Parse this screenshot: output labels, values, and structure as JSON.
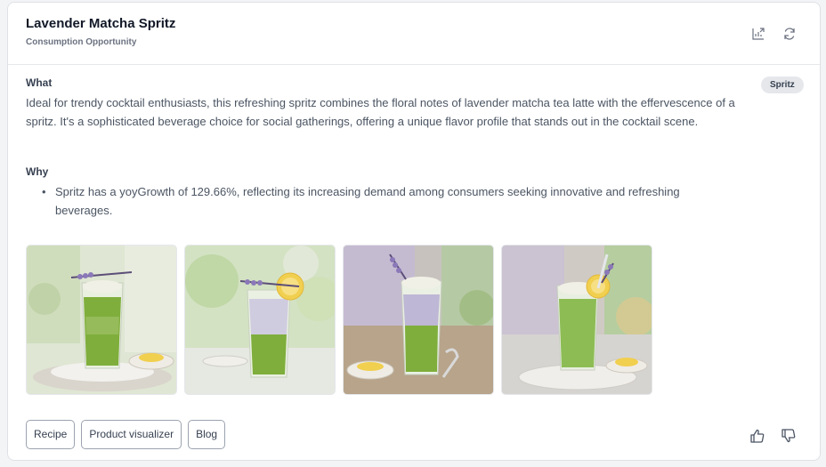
{
  "card": {
    "title": "Lavender Matcha Spritz",
    "subtitle": "Consumption Opportunity",
    "tag": "Spritz"
  },
  "what": {
    "label": "What",
    "text": "Ideal for trendy cocktail enthusiasts, this refreshing spritz combines the floral notes of lavender matcha tea latte with the effervescence of a spritz. It's a sophisticated beverage choice for social gatherings, offering a unique flavor profile that stands out in the cocktail scene."
  },
  "why": {
    "label": "Why",
    "items": [
      "Spritz has a yoyGrowth of 129.66%, reflecting its increasing demand among consumers seeking innovative and refreshing beverages."
    ]
  },
  "images": [
    {
      "name": "lavender-matcha-spritz-image-1"
    },
    {
      "name": "lavender-matcha-spritz-image-2"
    },
    {
      "name": "lavender-matcha-spritz-image-3"
    },
    {
      "name": "lavender-matcha-spritz-image-4"
    }
  ],
  "actions": {
    "recipe": "Recipe",
    "product_visualizer": "Product visualizer",
    "blog": "Blog"
  },
  "icons": {
    "export": "chart-export-icon",
    "refresh": "refresh-icon",
    "like": "thumbs-up-icon",
    "dislike": "thumbs-down-icon"
  },
  "colors": {
    "matcha": "#7fae3c",
    "lavender": "#a99bd0",
    "lemon": "#f1cf4f"
  }
}
